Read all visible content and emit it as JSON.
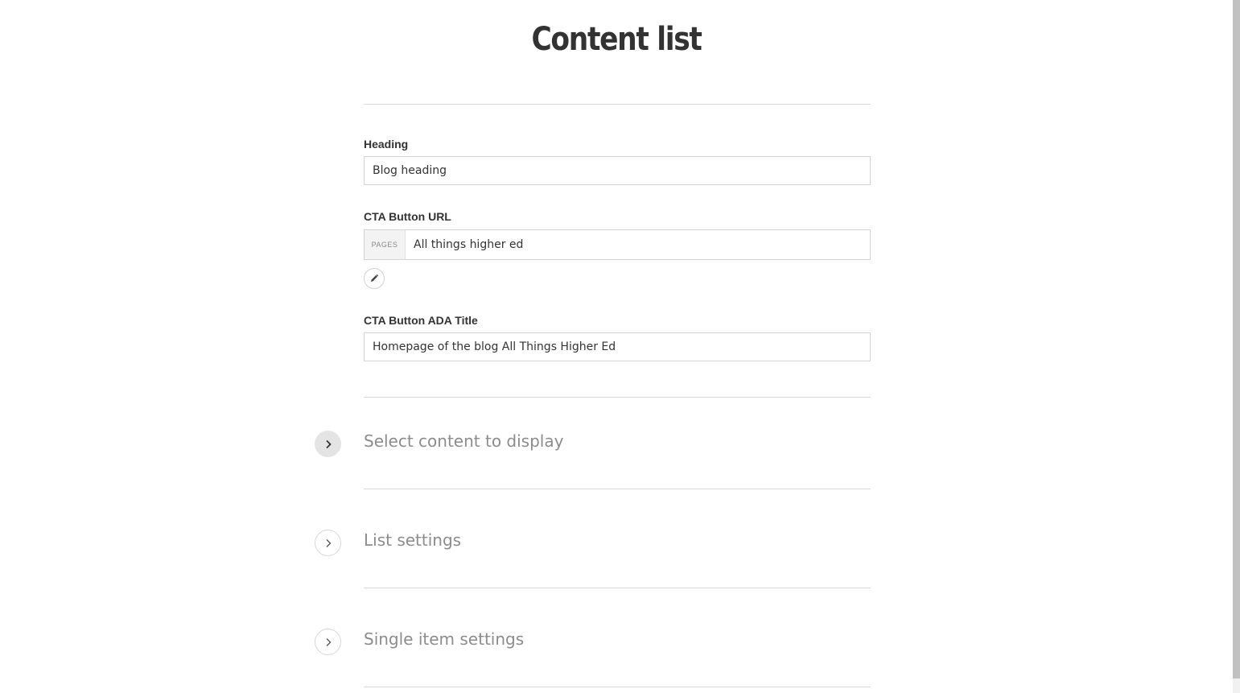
{
  "page_title": "Content list",
  "fields": {
    "heading": {
      "label": "Heading",
      "value": "Blog heading"
    },
    "cta_url": {
      "label": "CTA Button URL",
      "prefix": "PAGES",
      "value": "All things higher ed",
      "edit_icon": "pencil-icon"
    },
    "cta_ada_title": {
      "label": "CTA Button ADA Title",
      "value": "Homepage of the blog All Things Higher Ed"
    }
  },
  "sections": [
    {
      "label": "Select content to display",
      "expanded_style": true,
      "icon": "chevron-right-icon"
    },
    {
      "label": "List settings",
      "expanded_style": false,
      "icon": "chevron-right-icon"
    },
    {
      "label": "Single item settings",
      "expanded_style": false,
      "icon": "chevron-right-icon"
    }
  ],
  "colors": {
    "text": "#333333",
    "muted": "#8c8c8c",
    "border": "#d4d4d4",
    "divider": "#d9d9d9",
    "active_toggle_bg": "#e4e4e4"
  }
}
